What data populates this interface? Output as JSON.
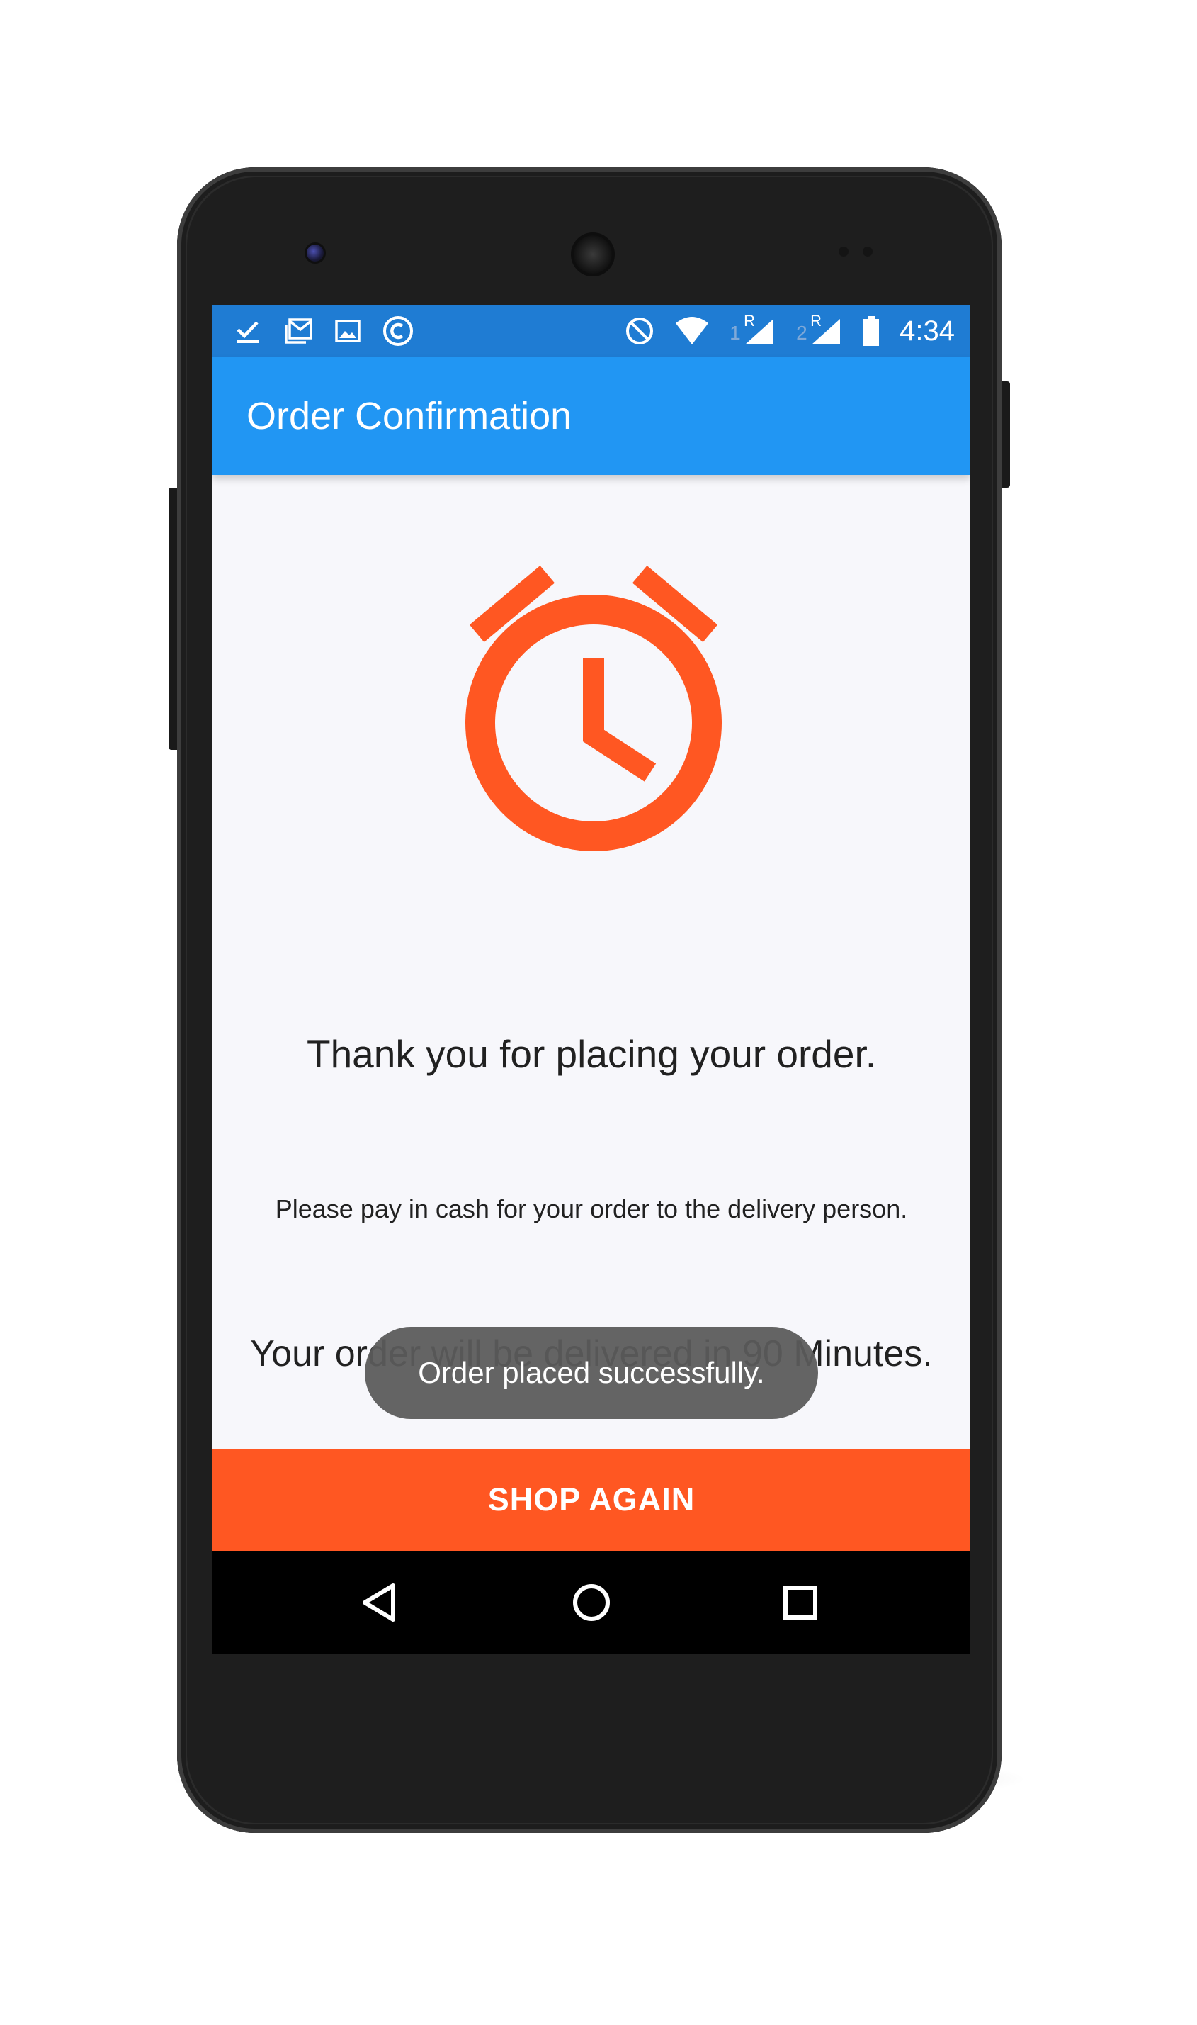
{
  "status_bar": {
    "time": "4:34",
    "left_icons": [
      "check-icon",
      "gmail-icon",
      "gallery-icon",
      "app-c-icon"
    ],
    "right_icons": [
      "do-not-disturb-icon",
      "wifi-icon",
      "sim1-signal-icon",
      "sim2-signal-icon",
      "battery-icon"
    ],
    "sim1_label": "1",
    "sim2_label": "2",
    "roaming_label": "R",
    "color": "#1f7cd3"
  },
  "app_bar": {
    "title": "Order Confirmation",
    "color": "#2196f3"
  },
  "content": {
    "icon": "alarm-clock-icon",
    "icon_color": "#ff5722",
    "thanks_message": "Thank you for placing your order.",
    "payment_message": "Please pay in cash for your order to the delivery person.",
    "delivery_message": "Your order will be delivered in 90 Minutes."
  },
  "toast": {
    "text": "Order placed successfully."
  },
  "primary_action": {
    "label": "SHOP AGAIN",
    "color": "#ff5722"
  },
  "nav_bar": {
    "buttons": [
      "back-icon",
      "home-icon",
      "recents-icon"
    ]
  }
}
